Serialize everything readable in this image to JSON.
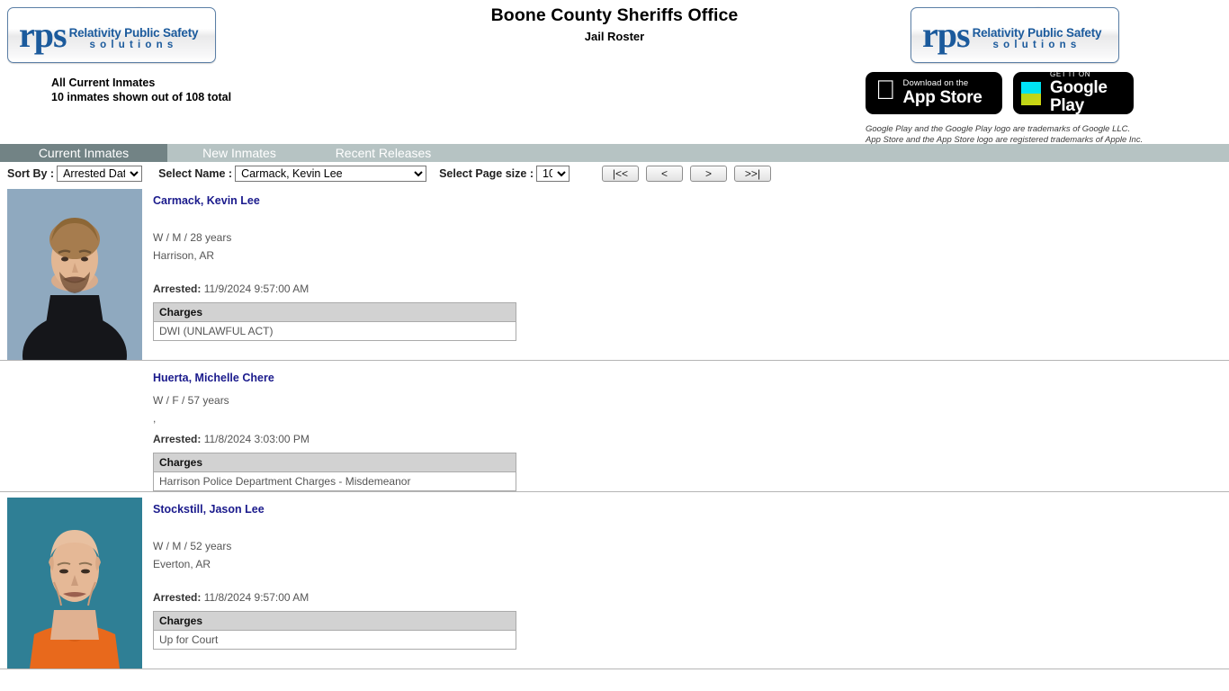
{
  "header": {
    "agency_title": "Boone County Sheriffs Office",
    "page_subtitle": "Jail Roster",
    "logo": {
      "mark": "rps",
      "line1": "Relativity Public Safety",
      "line2": "solutions",
      "watermark": "RPS"
    },
    "counts": {
      "line1": "All Current Inmates",
      "line2": "10 inmates shown out of 108 total"
    },
    "badges": {
      "apple": {
        "small": "Download on the",
        "big": "App Store",
        "icon": "apple-icon"
      },
      "google": {
        "small": "GET IT ON",
        "big": "Google Play",
        "icon": "google-play-icon"
      }
    },
    "trademark_line1": "Google Play and the Google Play logo are trademarks of Google LLC.",
    "trademark_line2": "App Store and the App Store logo are registered trademarks of Apple Inc."
  },
  "tabs": [
    {
      "label": "Current Inmates",
      "active": true
    },
    {
      "label": "New Inmates",
      "active": false
    },
    {
      "label": "Recent Releases",
      "active": false
    }
  ],
  "toolbar": {
    "sort_label": "Sort By :",
    "sort_value": "Arrested Date",
    "name_label": "Select Name :",
    "name_value": "Carmack, Kevin Lee",
    "pagesize_label": "Select Page size :",
    "pagesize_value": "10",
    "pager": {
      "first": "|<<",
      "prev": "<",
      "next": ">",
      "last": ">>|"
    }
  },
  "charges_header": "Charges",
  "arrested_label": "Arrested:",
  "inmates": [
    {
      "name": "Carmack, Kevin Lee",
      "demographics": "W / M / 28 years",
      "location": "Harrison, AR",
      "arrested": "11/9/2024 9:57:00 AM",
      "charges": [
        "DWI (UNLAWFUL ACT)"
      ],
      "has_photo": true,
      "photo_bg": "#8fa9bf"
    },
    {
      "name": "Huerta, Michelle Chere",
      "demographics": "W / F / 57 years",
      "location": ",",
      "arrested": "11/8/2024 3:03:00 PM",
      "charges": [
        "Harrison Police Department Charges - Misdemeanor"
      ],
      "has_photo": false,
      "photo_bg": "#ffffff"
    },
    {
      "name": "Stockstill, Jason Lee",
      "demographics": "W / M / 52 years",
      "location": "Everton, AR",
      "arrested": "11/8/2024 9:57:00 AM",
      "charges": [
        "Up for Court"
      ],
      "has_photo": true,
      "photo_bg": "#2f7f95"
    }
  ],
  "colors": {
    "tab_active_bg": "#728385",
    "tab_bar_bg": "#b6c3c3",
    "link": "#1a1a8c",
    "charges_header_bg": "#d2d2d2"
  }
}
